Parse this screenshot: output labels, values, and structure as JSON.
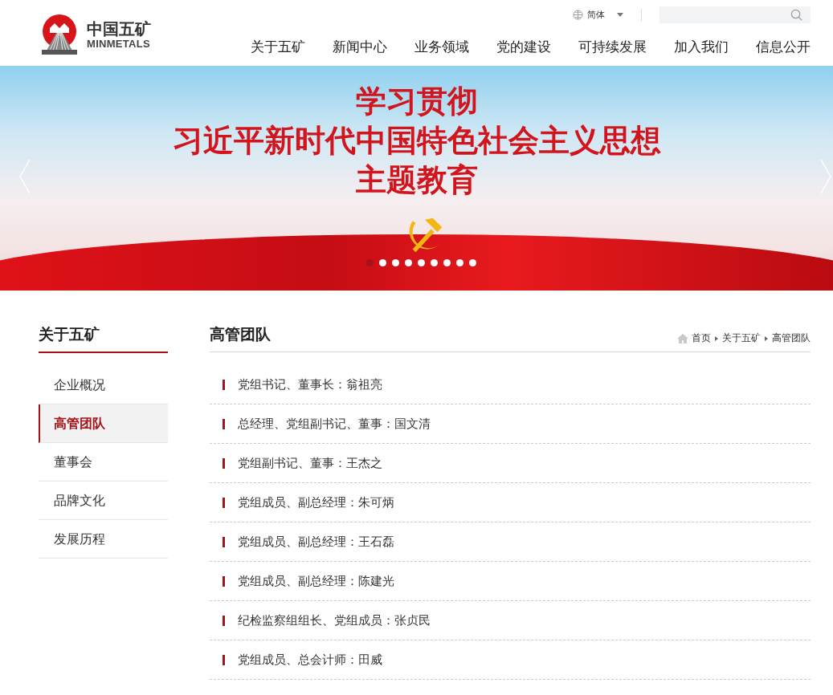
{
  "header": {
    "logo": {
      "name": "中国五矿",
      "subtitle": "MINMETALS"
    },
    "language": "简体",
    "nav": [
      {
        "label": "关于五矿",
        "selected": false
      },
      {
        "label": "新闻中心",
        "selected": false
      },
      {
        "label": "业务领域",
        "selected": false
      },
      {
        "label": "党的建设",
        "selected": false
      },
      {
        "label": "可持续发展",
        "selected": false
      },
      {
        "label": "加入我们",
        "selected": false
      },
      {
        "label": "信息公开",
        "selected": false
      }
    ]
  },
  "banner": {
    "lines": [
      "学习贯彻",
      "习近平新时代中国特色社会主义思想",
      "主题教育"
    ],
    "dots": [
      {
        "selected": true
      },
      {
        "selected": false
      },
      {
        "selected": false
      },
      {
        "selected": false
      },
      {
        "selected": false
      },
      {
        "selected": false
      },
      {
        "selected": false
      },
      {
        "selected": false
      },
      {
        "selected": false
      }
    ]
  },
  "sidebar": {
    "title": "关于五矿",
    "items": [
      {
        "label": "企业概况",
        "selected": false
      },
      {
        "label": "高管团队",
        "selected": true
      },
      {
        "label": "董事会",
        "selected": false
      },
      {
        "label": "品牌文化",
        "selected": false
      },
      {
        "label": "发展历程",
        "selected": false
      }
    ]
  },
  "content": {
    "title": "高管团队",
    "breadcrumb": [
      "首页",
      "关于五矿",
      "高管团队"
    ],
    "items": [
      "党组书记、董事长：翁祖亮",
      "总经理、党组副书记、董事：国文清",
      "党组副书记、董事：王杰之",
      "党组成员、副总经理：朱可炳",
      "党组成员、副总经理：王石磊",
      "党组成员、副总经理：陈建光",
      "纪检监察组组长、党组成员：张贞民",
      "党组成员、总会计师：田威"
    ]
  }
}
